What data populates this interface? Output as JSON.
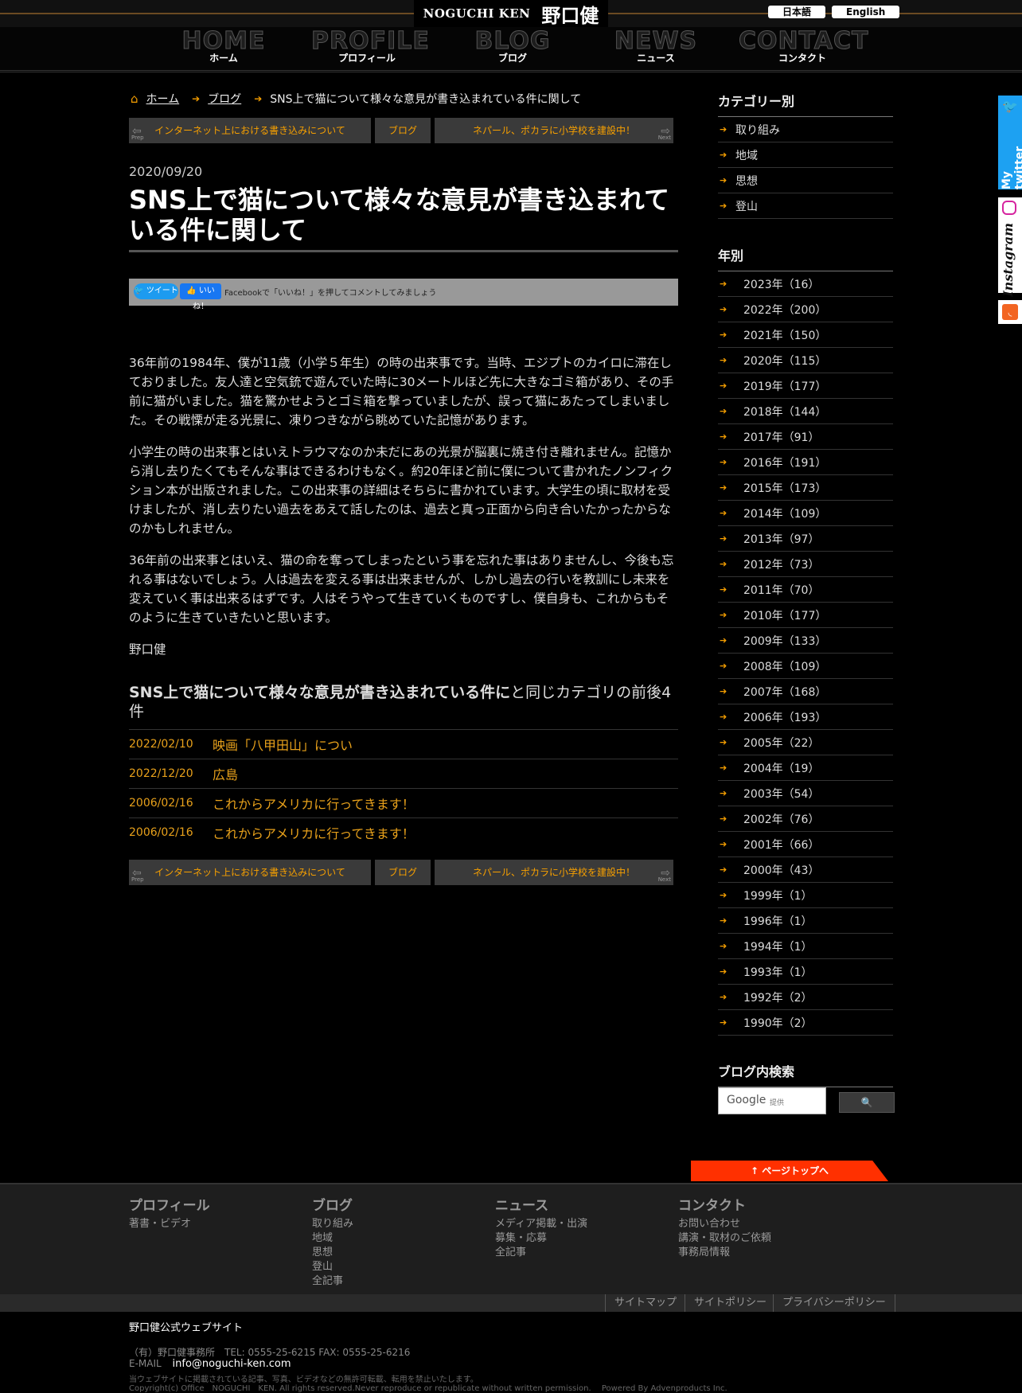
{
  "header": {
    "logo_en": "NOGUCHI KEN",
    "logo_jp": "野口健",
    "lang_ja": "日本語",
    "lang_en": "English"
  },
  "nav": [
    {
      "big": "HOME",
      "small": "ホーム"
    },
    {
      "big": "PROFILE",
      "small": "プロフィール"
    },
    {
      "big": "BLOG",
      "small": "ブログ"
    },
    {
      "big": "NEWS",
      "small": "ニュース"
    },
    {
      "big": "CONTACT",
      "small": "コンタクト"
    }
  ],
  "breadcrumb": {
    "home": "ホーム",
    "blog": "ブログ",
    "current": "SNS上で猫について様々な意見が書き込まれている件に関して"
  },
  "pager": {
    "prev_tag": "Prep",
    "next_tag": "Next",
    "prev_title": "インターネット上における書き込みについて",
    "category": "ブログ",
    "next_title": "ネパール、ポカラに小学校を建設中！"
  },
  "article": {
    "date": "2020/09/20",
    "title": "SNS上で猫について様々な意見が書き込まれている件に関して",
    "share_tweet": "ツイート",
    "share_like": "いいね！",
    "share_fb_text": "Facebookで「いいね！」を押してコメントしてみましょう",
    "paragraphs": [
      "36年前の1984年、僕が11歳（小学５年生）の時の出来事です。当時、エジプトのカイロに滞在しておりました。友人達と空気銃で遊んでいた時に30メートルほど先に大きなゴミ箱があり、その手前に猫がいました。猫を驚かせようとゴミ箱を撃っていましたが、誤って猫にあたってしまいました。その戦慄が走る光景に、凍りつきながら眺めていた記憶があります。",
      "小学生の時の出来事とはいえトラウマなのか未だにあの光景が脳裏に焼き付き離れません。記憶から消し去りたくてもそんな事はできるわけもなく。約20年ほど前に僕について書かれたノンフィクション本が出版されました。この出来事の詳細はそちらに書かれています。大学生の頃に取材を受けましたが、消し去りたい過去をあえて話したのは、過去と真っ正面から向き合いたかったからなのかもしれません。",
      "36年前の出来事とはいえ、猫の命を奪ってしまったという事を忘れた事はありませんし、今後も忘れる事はないでしょう。人は過去を変える事は出来ませんが、しかし過去の行いを教訓にし未来を変えていく事は出来るはずです。人はそうやって生きていくものですし、僕自身も、これからもそのように生きていきたいと思います。",
      "野口健"
    ]
  },
  "related": {
    "heading_bold": "SNS上で猫について様々な意見が書き込まれている件に",
    "heading_rest": "と同じカテゴリの前後4件",
    "items": [
      {
        "date": "2022/02/10",
        "title": "映画「八甲田山」につい"
      },
      {
        "date": "2022/12/20",
        "title": "広島"
      },
      {
        "date": "2006/02/16",
        "title": "これからアメリカに行ってきます！"
      },
      {
        "date": "2006/02/16",
        "title": "これからアメリカに行ってきます！"
      }
    ]
  },
  "sidebar": {
    "category_title": "カテゴリー別",
    "categories": [
      "取り組み",
      "地域",
      "思想",
      "登山"
    ],
    "year_title": "年別",
    "years": [
      "2023年（16）",
      "2022年（200）",
      "2021年（150）",
      "2020年（115）",
      "2019年（177）",
      "2018年（144）",
      "2017年（91）",
      "2016年（191）",
      "2015年（173）",
      "2014年（109）",
      "2013年（97）",
      "2012年（73）",
      "2011年（70）",
      "2010年（177）",
      "2009年（133）",
      "2008年（109）",
      "2007年（168）",
      "2006年（193）",
      "2005年（22）",
      "2004年（19）",
      "2003年（54）",
      "2002年（76）",
      "2001年（66）",
      "2000年（43）",
      "1999年（1）",
      "1996年（1）",
      "1994年（1）",
      "1993年（1）",
      "1992年（2）",
      "1990年（2）"
    ],
    "search_title": "ブログ内検索",
    "search_google": "Google",
    "search_powered": "提供"
  },
  "social": {
    "twitter": "My twitter",
    "instagram": "Instagram"
  },
  "footer": {
    "pagetop": "ページトップへ",
    "cols": [
      {
        "h": "プロフィール",
        "links": [
          "著書・ビデオ"
        ]
      },
      {
        "h": "ブログ",
        "links": [
          "取り組み",
          "地域",
          "思想",
          "登山",
          "全記事"
        ]
      },
      {
        "h": "ニュース",
        "links": [
          "メディア掲載・出演",
          "募集・応募",
          "全記事"
        ]
      },
      {
        "h": "コンタクト",
        "links": [
          "お問い合わせ",
          "講演・取材のご依頼",
          "事務局情報"
        ]
      }
    ],
    "sitemap": "サイトマップ",
    "policy": "サイトポリシー",
    "privacy": "プライバシーポリシー",
    "site_name": "野口健公式ウェブサイト",
    "office": "（有）野口健事務所　TEL: 0555-25-6215 FAX: 0555-25-6216",
    "email_label": "E-MAIL",
    "email": "info@noguchi-ken.com",
    "notice": "当ウェブサイトに掲載されている記事、写真、ビデオなどの無許可転載、転用を禁止いたします。",
    "copyright": "Copyright(c) Office　NOGUCHI　KEN. All rights reserved.Never reproduce or republicate without written permission.　 Powered By Advenproducts Inc."
  }
}
